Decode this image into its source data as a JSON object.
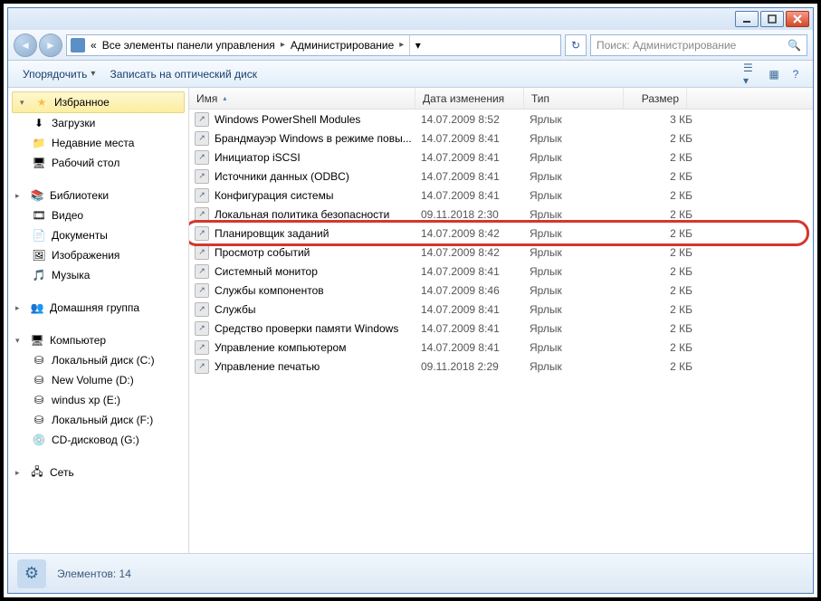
{
  "breadcrumb": {
    "prefix": "«",
    "part1": "Все элементы панели управления",
    "part2": "Администрирование"
  },
  "search": {
    "placeholder": "Поиск: Администрирование"
  },
  "toolbar": {
    "organize": "Упорядочить",
    "burn": "Записать на оптический диск"
  },
  "sidebar": {
    "favorites": "Избранное",
    "fav_items": [
      "Загрузки",
      "Недавние места",
      "Рабочий стол"
    ],
    "libraries": "Библиотеки",
    "lib_items": [
      "Видео",
      "Документы",
      "Изображения",
      "Музыка"
    ],
    "homegroup": "Домашняя группа",
    "computer": "Компьютер",
    "comp_items": [
      "Локальный диск (C:)",
      "New Volume (D:)",
      "windus xp (E:)",
      "Локальный диск (F:)",
      "CD-дисковод (G:)"
    ],
    "network": "Сеть"
  },
  "columns": {
    "name": "Имя",
    "date": "Дата изменения",
    "type": "Тип",
    "size": "Размер"
  },
  "files": [
    {
      "name": "Windows PowerShell Modules",
      "date": "14.07.2009 8:52",
      "type": "Ярлык",
      "size": "3 КБ"
    },
    {
      "name": "Брандмауэр Windows в режиме повы...",
      "date": "14.07.2009 8:41",
      "type": "Ярлык",
      "size": "2 КБ"
    },
    {
      "name": "Инициатор iSCSI",
      "date": "14.07.2009 8:41",
      "type": "Ярлык",
      "size": "2 КБ"
    },
    {
      "name": "Источники данных (ODBC)",
      "date": "14.07.2009 8:41",
      "type": "Ярлык",
      "size": "2 КБ"
    },
    {
      "name": "Конфигурация системы",
      "date": "14.07.2009 8:41",
      "type": "Ярлык",
      "size": "2 КБ"
    },
    {
      "name": "Локальная политика безопасности",
      "date": "09.11.2018 2:30",
      "type": "Ярлык",
      "size": "2 КБ"
    },
    {
      "name": "Планировщик заданий",
      "date": "14.07.2009 8:42",
      "type": "Ярлык",
      "size": "2 КБ",
      "hl": true
    },
    {
      "name": "Просмотр событий",
      "date": "14.07.2009 8:42",
      "type": "Ярлык",
      "size": "2 КБ"
    },
    {
      "name": "Системный монитор",
      "date": "14.07.2009 8:41",
      "type": "Ярлык",
      "size": "2 КБ"
    },
    {
      "name": "Службы компонентов",
      "date": "14.07.2009 8:46",
      "type": "Ярлык",
      "size": "2 КБ"
    },
    {
      "name": "Службы",
      "date": "14.07.2009 8:41",
      "type": "Ярлык",
      "size": "2 КБ"
    },
    {
      "name": "Средство проверки памяти Windows",
      "date": "14.07.2009 8:41",
      "type": "Ярлык",
      "size": "2 КБ"
    },
    {
      "name": "Управление компьютером",
      "date": "14.07.2009 8:41",
      "type": "Ярлык",
      "size": "2 КБ"
    },
    {
      "name": "Управление печатью",
      "date": "09.11.2018 2:29",
      "type": "Ярлык",
      "size": "2 КБ"
    }
  ],
  "status": {
    "label": "Элементов: 14"
  }
}
